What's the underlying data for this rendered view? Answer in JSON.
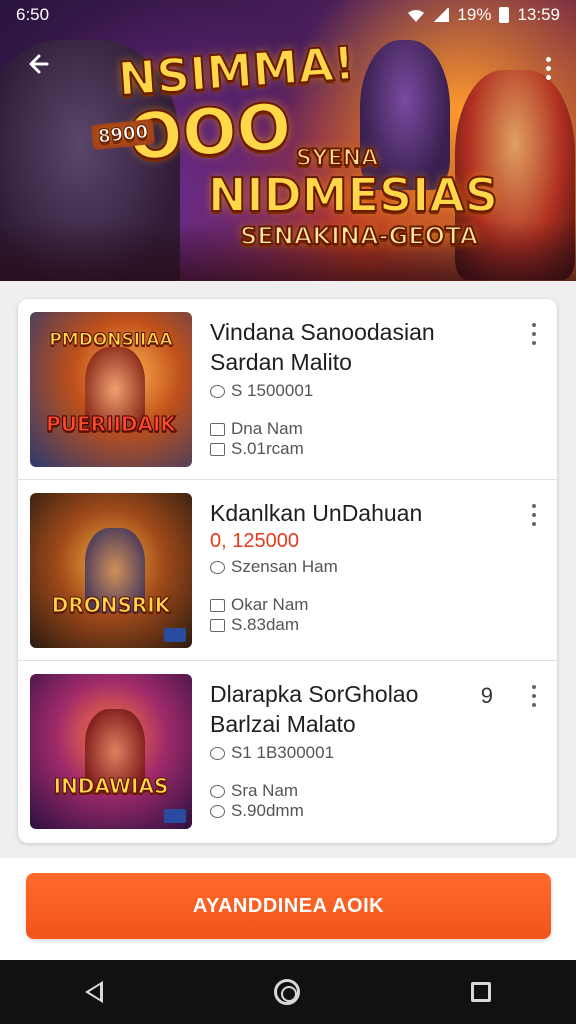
{
  "status_bar": {
    "time_left": "6:50",
    "battery": "19%",
    "time_right": "13:59"
  },
  "banner": {
    "line1": "NSIMMA!",
    "line2": "8900",
    "line3": "OOO",
    "line4": "SYENA",
    "line5": "NIDMESIAS",
    "line6": "SENAKINA-GEOTA"
  },
  "items": [
    {
      "thumb_top": "PMDONSIIAA",
      "thumb_bottom": "PUERIIDAIK",
      "title_1": "Vindana Sanoodasian",
      "title_2": "Sardan Malito",
      "line_a": "S 1500001",
      "line_b": "Dna Nam",
      "line_c": "S.01rcam"
    },
    {
      "thumb_top": "",
      "thumb_bottom": "DRONSRIK",
      "title_1": "Kdanlkan UnDahuan",
      "price": "0, 125000",
      "line_a": "Szensan Ham",
      "line_b": "Okar Nam",
      "line_c": "S.83dam"
    },
    {
      "thumb_top": "",
      "thumb_bottom": "INDAWIAS",
      "title_1": "Dlarapka SorGholao",
      "title_2": "Barlzai Malato",
      "badge": "9",
      "line_a": "S1 1B300001",
      "line_b": "Sra Nam",
      "line_c": "S.90dmm"
    }
  ],
  "cta": {
    "label": "AYANDDINEA AOIK"
  },
  "colors": {
    "accent": "#f2541a",
    "price": "#e83a1a"
  },
  "icons": [
    "back-arrow-icon",
    "more-vert-icon",
    "wifi-icon",
    "signal-icon",
    "battery-icon",
    "nav-back-icon",
    "nav-home-icon",
    "nav-recents-icon"
  ]
}
